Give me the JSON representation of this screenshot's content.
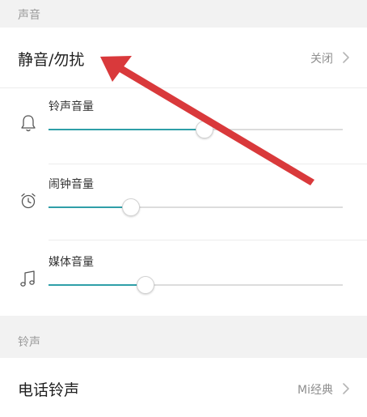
{
  "sound_section": {
    "header": "声音",
    "dnd": {
      "label": "静音/勿扰",
      "value": "关闭"
    },
    "volumes": [
      {
        "label": "铃声音量",
        "icon": "bell-icon",
        "level": 0.53
      },
      {
        "label": "闹钟音量",
        "icon": "alarm-clock-icon",
        "level": 0.28
      },
      {
        "label": "媒体音量",
        "icon": "music-note-icon",
        "level": 0.33
      }
    ]
  },
  "ringtone_section": {
    "header": "铃声",
    "phone_ringtone": {
      "label": "电话铃声",
      "value": "Mi经典"
    }
  },
  "colors": {
    "accent": "#2f9fa8",
    "annotation_arrow": "#d9393b"
  }
}
